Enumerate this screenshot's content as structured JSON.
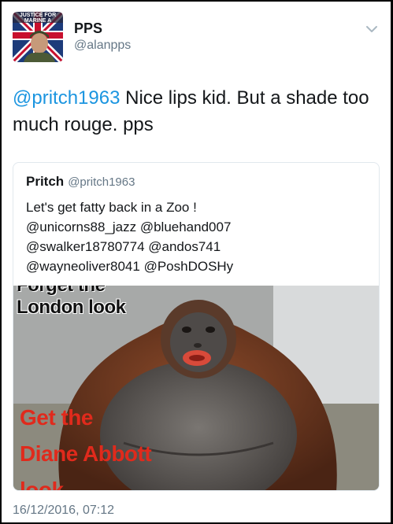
{
  "author": {
    "display_name": "PPS",
    "handle": "@alanpps",
    "avatar_banner_text": "JUSTICE FOR MARINE A"
  },
  "tweet": {
    "mention": "@pritch1963",
    "text": " Nice lips kid. But a shade too much rouge. pps",
    "timestamp": "16/12/2016, 07:12"
  },
  "quoted_tweet": {
    "display_name": "Pritch",
    "handle": "@pritch1963",
    "text": "Let's get fatty back in a Zoo !\n@unicorns88_jazz @bluehand007\n@swalker18780774 @andos741\n@wayneoliver8041 @PoshDOSHy",
    "image": {
      "caption_partial_top": "Forget the",
      "caption_top": "London look",
      "caption_red_1": "Get the",
      "caption_red_2": "Diane Abbott",
      "caption_partial_bottom": "look"
    }
  },
  "colors": {
    "accent": "#1b95e0",
    "text": "#14171a",
    "secondary_text": "#657786",
    "border": "#e1e8ed",
    "caption_red": "#e02a1c"
  }
}
